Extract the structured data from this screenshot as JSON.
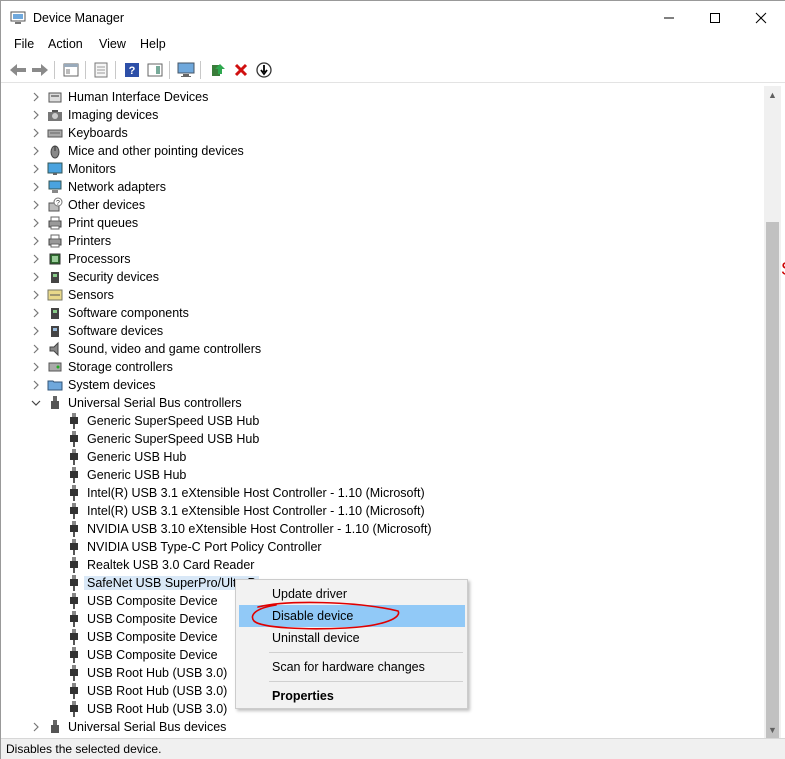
{
  "window": {
    "title": "Device Manager",
    "controls": {
      "minimize": "—",
      "maximize": "☐",
      "close": "✕"
    }
  },
  "menu": [
    "File",
    "Action",
    "View",
    "Help"
  ],
  "tree": {
    "categories_top": [
      {
        "label": "Human Interface Devices",
        "icon": "hid-icon"
      },
      {
        "label": "Imaging devices",
        "icon": "camera-icon"
      },
      {
        "label": "Keyboards",
        "icon": "keyboard-icon"
      },
      {
        "label": "Mice and other pointing devices",
        "icon": "mouse-icon"
      },
      {
        "label": "Monitors",
        "icon": "monitor-icon"
      },
      {
        "label": "Network adapters",
        "icon": "network-icon"
      },
      {
        "label": "Other devices",
        "icon": "unknown-device-icon"
      },
      {
        "label": "Print queues",
        "icon": "printer-icon"
      },
      {
        "label": "Printers",
        "icon": "printer-icon"
      },
      {
        "label": "Processors",
        "icon": "processor-icon"
      },
      {
        "label": "Security devices",
        "icon": "security-icon"
      },
      {
        "label": "Sensors",
        "icon": "sensor-icon"
      },
      {
        "label": "Software components",
        "icon": "software-component-icon"
      },
      {
        "label": "Software devices",
        "icon": "software-device-icon"
      },
      {
        "label": "Sound, video and game controllers",
        "icon": "speaker-icon"
      },
      {
        "label": "Storage controllers",
        "icon": "storage-icon"
      },
      {
        "label": "System devices",
        "icon": "system-folder-icon"
      }
    ],
    "usb_category": "Universal Serial Bus controllers",
    "usb_children": [
      "Generic SuperSpeed USB Hub",
      "Generic SuperSpeed USB Hub",
      "Generic USB Hub",
      "Generic USB Hub",
      "Intel(R) USB 3.1 eXtensible Host Controller - 1.10 (Microsoft)",
      "Intel(R) USB 3.1 eXtensible Host Controller - 1.10 (Microsoft)",
      "NVIDIA USB 3.10 eXtensible Host Controller - 1.10 (Microsoft)",
      "NVIDIA USB Type-C Port Policy Controller",
      "Realtek USB 3.0 Card Reader",
      "SafeNet USB SuperPro/UltraP",
      "USB Composite Device",
      "USB Composite Device",
      "USB Composite Device",
      "USB Composite Device",
      "USB Root Hub (USB 3.0)",
      "USB Root Hub (USB 3.0)",
      "USB Root Hub (USB 3.0)"
    ],
    "selected_child_index": 9,
    "last_category": "Universal Serial Bus devices"
  },
  "context_menu": {
    "items": [
      {
        "label": "Update driver"
      },
      {
        "label": "Disable device"
      },
      {
        "label": "Uninstall device"
      },
      {
        "label": "Scan for hardware changes"
      },
      {
        "label": "Properties"
      }
    ],
    "highlighted_index": 1
  },
  "status": "Disables the selected device.",
  "colors": {
    "selection": "#d9e8f7",
    "menu_hover": "#91c9f7",
    "annotation": "#e00000"
  }
}
